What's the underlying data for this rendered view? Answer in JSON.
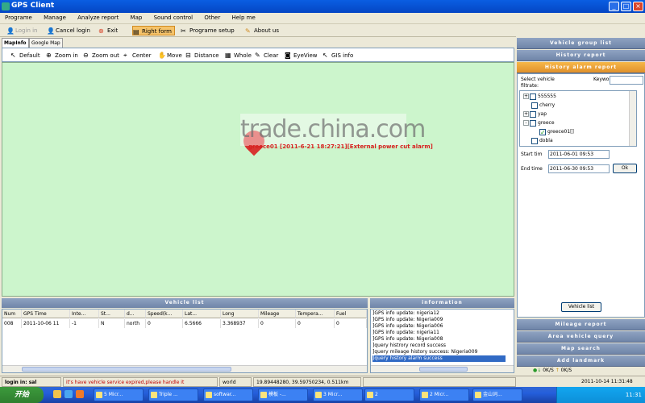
{
  "window": {
    "title": "GPS Client",
    "minimize": "_",
    "maximize": "□",
    "close": "×"
  },
  "menu": [
    "Programe",
    "Manage",
    "Analyze report",
    "Map",
    "Sound control",
    "Other",
    "Help me"
  ],
  "toolbar": {
    "login": "Login in",
    "cancel_login": "Cancel login",
    "exit": "Exit",
    "right_form": "Right form",
    "programe_setup": "Programe setup",
    "about_us": "About us"
  },
  "map_tabs": [
    "MapInfo",
    "Google Map"
  ],
  "map_tools": [
    "Default",
    "Zoom in",
    "Zoom out",
    "Center",
    "Move",
    "Distance",
    "Whole",
    "Clear",
    "EyeView",
    "GIS info"
  ],
  "map": {
    "alarm_text": "greece01 [2011-6-21 18:27:21][External power cut alarm]",
    "watermark": "trade.china.com"
  },
  "right_panel": {
    "headers": [
      "Vehicle group list",
      "History report",
      "History alarm report"
    ],
    "select_vehicle_label": "Select vehicle filtrate:",
    "keyword_label": "Keywo",
    "tree": [
      {
        "label": "555555",
        "checked": false,
        "expander": "+"
      },
      {
        "label": "cherry",
        "checked": false,
        "expander": ""
      },
      {
        "label": "yap",
        "checked": false,
        "expander": "+"
      },
      {
        "label": "greece",
        "checked": false,
        "expander": "-"
      },
      {
        "label": "greece01[]",
        "checked": true,
        "expander": ""
      },
      {
        "label": "dobla",
        "checked": false,
        "expander": ""
      }
    ],
    "start_time_label": "Start tim",
    "start_time_value": "2011-06-01 09:53",
    "end_time_label": "End time",
    "end_time_value": "2011-06-30 09:53",
    "ok_button": "Ok",
    "vehicle_list_button": "Vehicle list",
    "lower_headers": [
      "Mileage report",
      "Area vehicle query",
      "Map search",
      "Add landmark"
    ],
    "speed_down": "0K/S",
    "speed_up": "0K/S"
  },
  "vehicle_list": {
    "title": "Vehicle list",
    "columns": [
      "Num",
      "GPS Time",
      "Inte...",
      "St...",
      "d...",
      "Speed(k...",
      "Lat...",
      "Long",
      "Mileage",
      "Tempera...",
      "Fuel"
    ],
    "rows": [
      [
        "008",
        "2011-10-06 11",
        "-1",
        "N",
        "north",
        "0",
        "6.5666",
        "3.368937",
        "0",
        "0",
        "0"
      ]
    ]
  },
  "information": {
    "title": "information",
    "lines": [
      "]GPS info update: nigeria12",
      "]GPS info update: Nigeria009",
      "]GPS info update: Nigeria006",
      "]GPS info update: nigeria11",
      "]GPS info update: Nigeria008",
      "]query histrory record success",
      "]query mileage history success: Nigeria009",
      "]query history alarm success"
    ]
  },
  "status": {
    "login": "login in: sal",
    "message": "it's have vehicle service expired,please handle it",
    "world": "world",
    "coords": "19.89448280, 39.59750234, 0.511km",
    "datetime": "2011-10-14 11:31:48"
  },
  "taskbar": {
    "start": "开始",
    "items": [
      "5 Micr...",
      "Triple ...",
      "softwar...",
      "模板 -...",
      "3 Micr...",
      "2",
      "2 Micr...",
      "金山词..."
    ],
    "clock": "11:31"
  },
  "colors": {
    "map_bg": "#ccf5cc",
    "alarm": "#d82020",
    "title_bar": "#0a5ee2"
  }
}
